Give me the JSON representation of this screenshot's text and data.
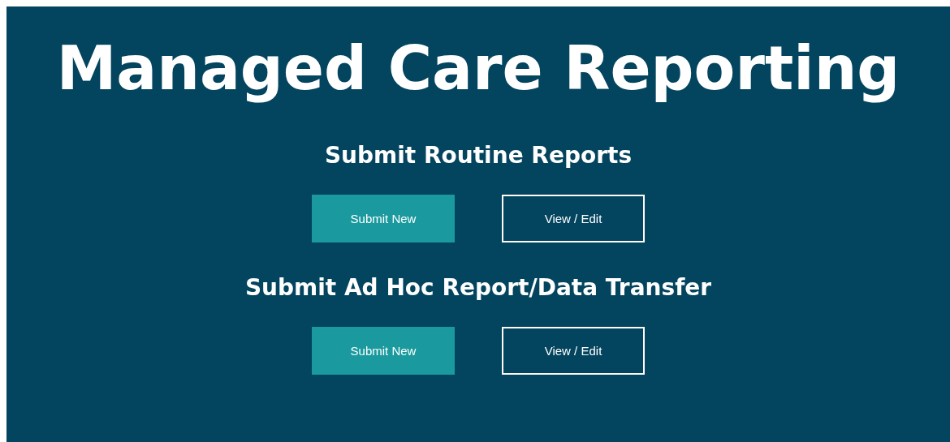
{
  "title": "Managed Care Reporting",
  "sections": [
    {
      "heading": "Submit Routine Reports",
      "buttons": [
        {
          "label": "Submit New",
          "kind": "filled"
        },
        {
          "label": "View / Edit",
          "kind": "outline"
        }
      ]
    },
    {
      "heading": "Submit Ad Hoc Report/Data Transfer",
      "buttons": [
        {
          "label": "Submit New",
          "kind": "filled"
        },
        {
          "label": "View / Edit",
          "kind": "outline"
        }
      ]
    }
  ]
}
